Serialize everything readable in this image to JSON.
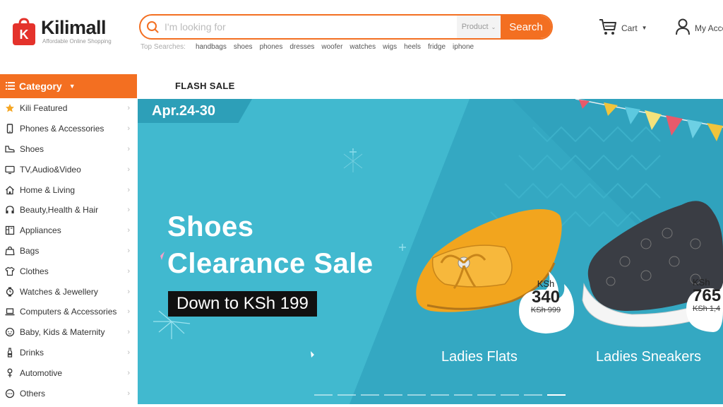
{
  "header": {
    "logo_name": "Kilimall",
    "logo_tagline": "Affordable Online Shopping",
    "logo_letter": "K",
    "search_placeholder": "I'm looking for",
    "search_type": "Product",
    "search_button": "Search",
    "top_searches_title": "Top Searches:",
    "top_searches": [
      "handbags",
      "shoes",
      "phones",
      "dresses",
      "woofer",
      "watches",
      "wigs",
      "heels",
      "fridge",
      "iphone"
    ],
    "cart_label": "Cart",
    "account_label": "My Account"
  },
  "sidebar": {
    "title": "Category",
    "items": [
      {
        "label": "Kili Featured",
        "icon": "star-icon"
      },
      {
        "label": "Phones & Accessories",
        "icon": "phone-icon"
      },
      {
        "label": "Shoes",
        "icon": "shoe-icon"
      },
      {
        "label": "TV,Audio&Video",
        "icon": "tv-icon"
      },
      {
        "label": "Home & Living",
        "icon": "home-icon"
      },
      {
        "label": "Beauty,Health & Hair",
        "icon": "beauty-icon"
      },
      {
        "label": "Appliances",
        "icon": "appliance-icon"
      },
      {
        "label": "Bags",
        "icon": "bag-icon"
      },
      {
        "label": "Clothes",
        "icon": "shirt-icon"
      },
      {
        "label": "Watches & Jewellery",
        "icon": "watch-icon"
      },
      {
        "label": "Computers & Accessories",
        "icon": "laptop-icon"
      },
      {
        "label": "Baby, Kids & Maternity",
        "icon": "baby-icon"
      },
      {
        "label": "Drinks",
        "icon": "bottle-icon"
      },
      {
        "label": "Automotive",
        "icon": "car-icon"
      },
      {
        "label": "Others",
        "icon": "more-icon"
      }
    ]
  },
  "flash_sale": "FLASH SALE",
  "banner": {
    "date": "Apr.24-30",
    "headline_line1": "Shoes",
    "headline_line2": "Clearance Sale",
    "down_to": "Down to KSh 199",
    "products": [
      {
        "label": "Ladies Flats",
        "currency": "KSh",
        "price": "340",
        "old_price": "KSh 999"
      },
      {
        "label": "Ladies Sneakers",
        "currency": "KSh",
        "price": "765",
        "old_price": "KSh 1,4"
      }
    ],
    "slides_total": 11,
    "slide_active": 11
  },
  "colors": {
    "brand_orange": "#f36f21",
    "banner_teal": "#41b9cf",
    "badge_teal": "#2d9fb8"
  }
}
